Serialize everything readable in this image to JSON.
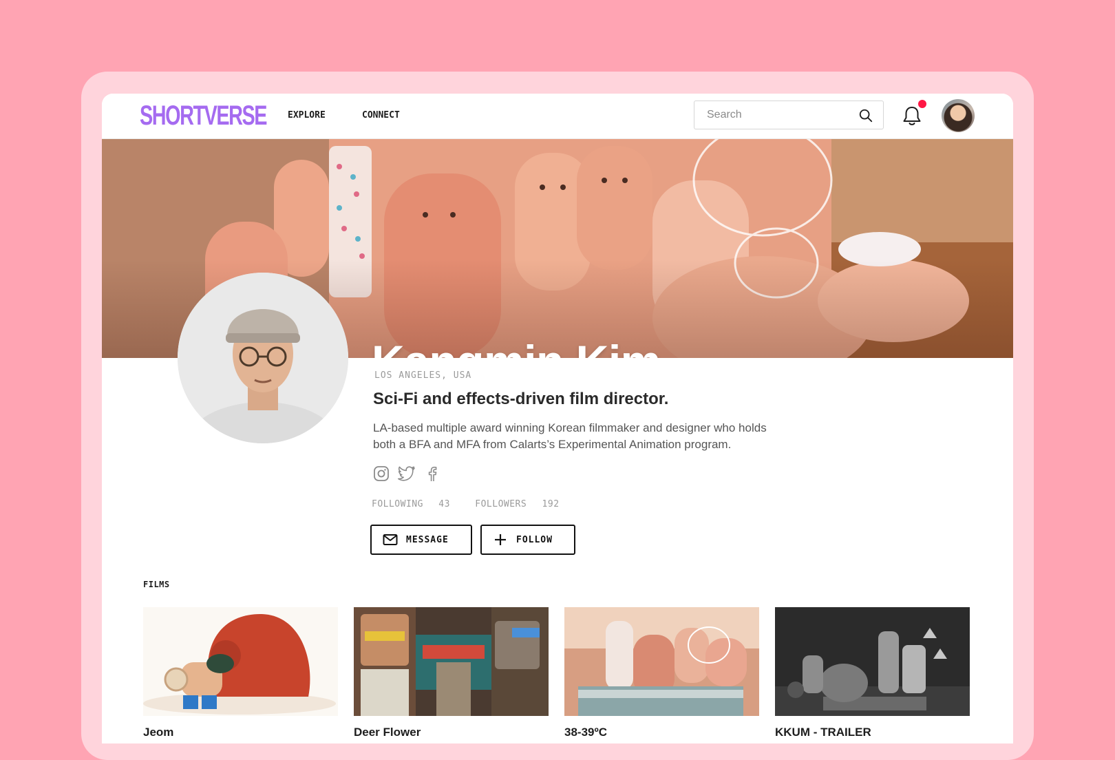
{
  "app": {
    "logo": "SHORTVERSE"
  },
  "nav": {
    "links": [
      "EXPLORE",
      "CONNECT"
    ],
    "search_placeholder": "Search"
  },
  "icons": {
    "search": "search-icon",
    "notifications": "bell-icon",
    "instagram": "instagram-icon",
    "twitter": "twitter-icon",
    "facebook": "facebook-icon",
    "message": "mail-icon",
    "follow": "plus-icon"
  },
  "colors": {
    "background": "#ffa4b3",
    "frame": "#ffd4dc",
    "logo": "#a56bf0",
    "notification_dot": "#ff1744"
  },
  "profile": {
    "name": "Kangmin Kim",
    "location": "LOS ANGELES, USA",
    "headline": "Sci-Fi and effects-driven film director.",
    "bio_line1": "LA-based multiple award winning Korean filmmaker and designer who holds",
    "bio_line2": "both a BFA and MFA from Calarts’s Experimental Animation program.",
    "following_label": "FOLLOWING",
    "following_count": "43",
    "followers_label": "FOLLOWERS",
    "followers_count": "192"
  },
  "actions": {
    "message_label": "MESSAGE",
    "follow_label": "FOLLOW"
  },
  "films": {
    "heading": "FILMS",
    "items": [
      {
        "title": "Jeom"
      },
      {
        "title": "Deer Flower"
      },
      {
        "title": "38-39ºC"
      },
      {
        "title": "KKUM - TRAILER"
      }
    ]
  }
}
